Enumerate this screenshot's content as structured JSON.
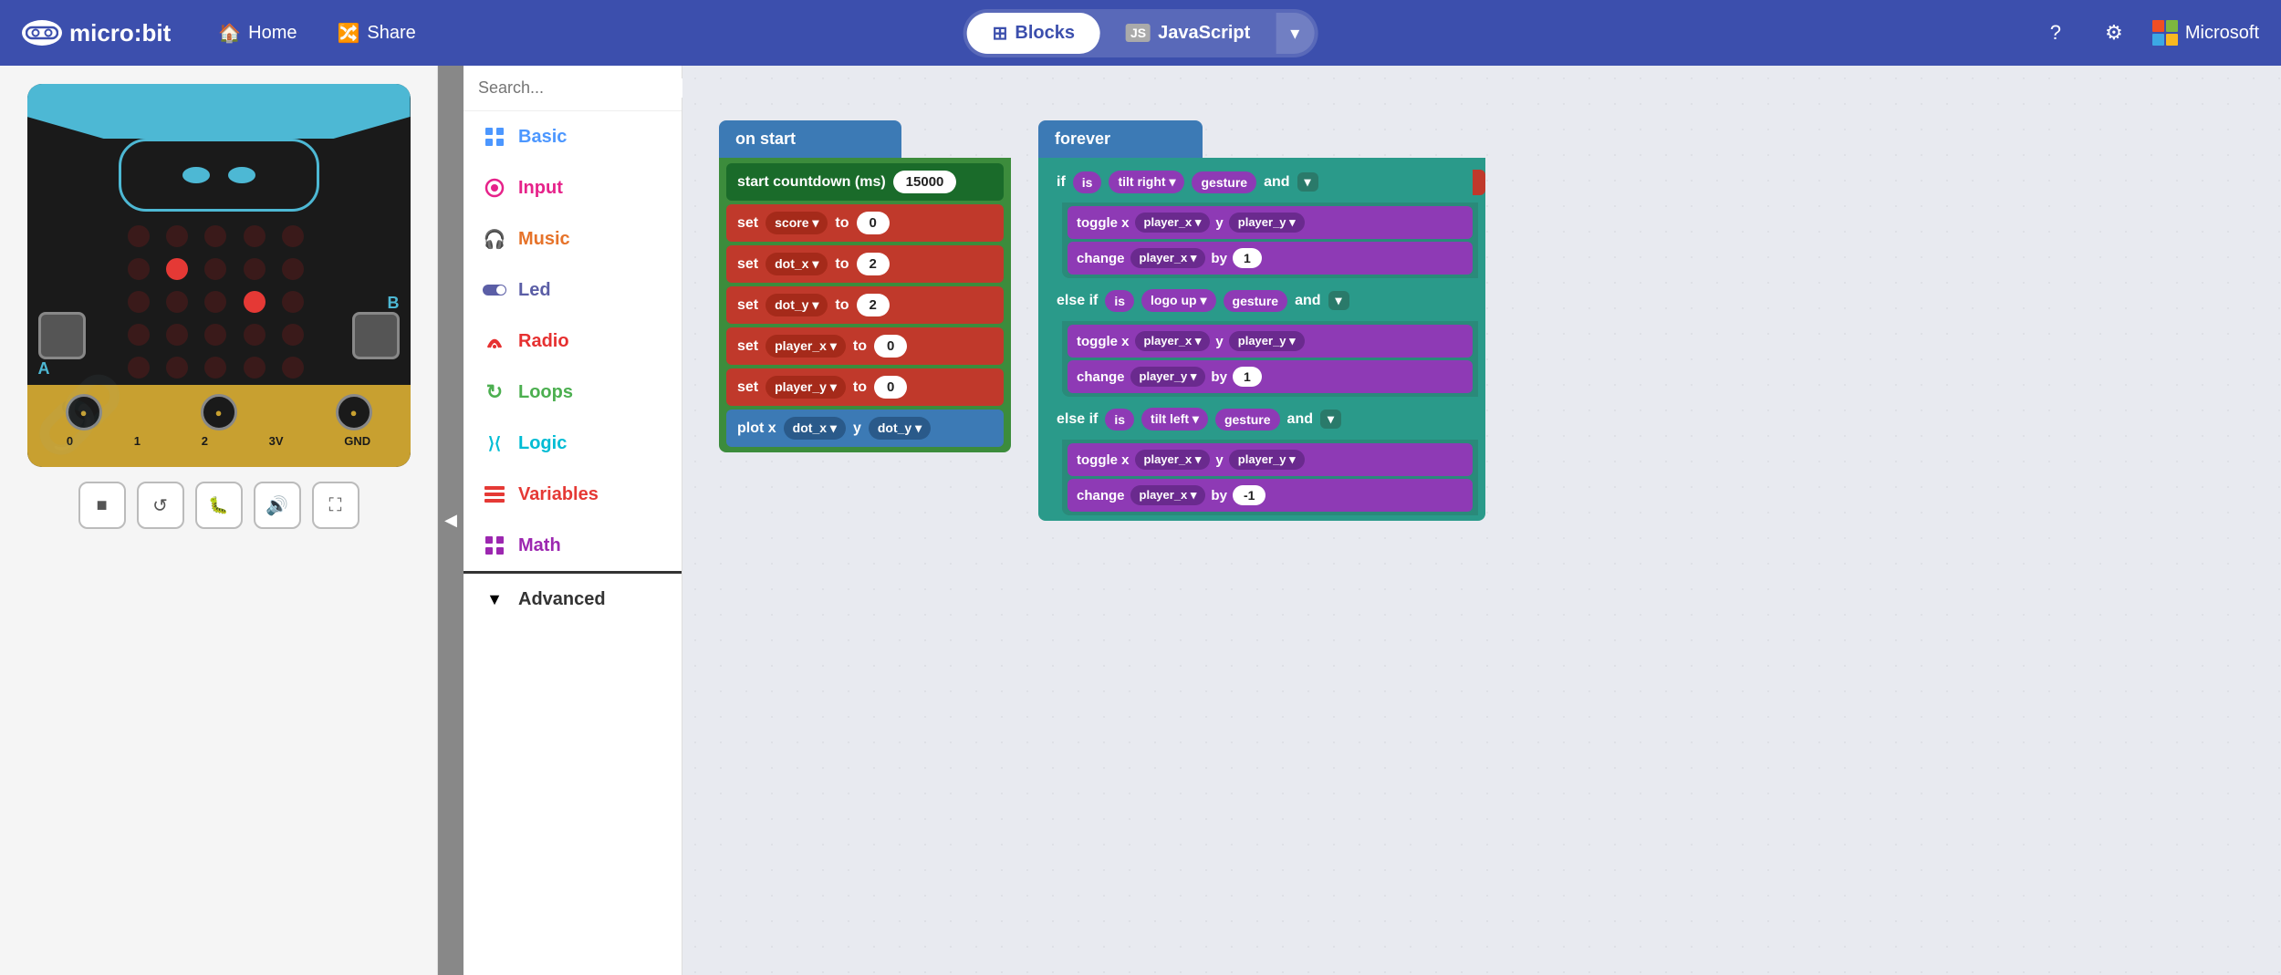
{
  "header": {
    "logo_text": "micro:bit",
    "home_label": "Home",
    "share_label": "Share",
    "blocks_label": "Blocks",
    "javascript_label": "JavaScript",
    "microsoft_label": "Microsoft"
  },
  "toolbox": {
    "search_placeholder": "Search...",
    "items": [
      {
        "id": "basic",
        "label": "Basic",
        "color": "#4c97ff",
        "icon": "grid"
      },
      {
        "id": "input",
        "label": "Input",
        "color": "#e6228a",
        "icon": "circle"
      },
      {
        "id": "music",
        "label": "Music",
        "color": "#e6732a",
        "icon": "headphones"
      },
      {
        "id": "led",
        "label": "Led",
        "color": "#5b5ea6",
        "icon": "toggle"
      },
      {
        "id": "radio",
        "label": "Radio",
        "color": "#e63030",
        "icon": "signal"
      },
      {
        "id": "loops",
        "label": "Loops",
        "color": "#4caf50",
        "icon": "refresh"
      },
      {
        "id": "logic",
        "label": "Logic",
        "color": "#00bcd4",
        "icon": "branch"
      },
      {
        "id": "variables",
        "label": "Variables",
        "color": "#e53935",
        "icon": "list"
      },
      {
        "id": "math",
        "label": "Math",
        "color": "#9c27b0",
        "icon": "grid2"
      },
      {
        "id": "advanced",
        "label": "Advanced",
        "color": "#333",
        "icon": "chevron"
      }
    ]
  },
  "on_start": {
    "hat_label": "on start",
    "countdown_label": "start countdown (ms)",
    "countdown_value": "15000",
    "rows": [
      {
        "label": "set",
        "var": "score",
        "connector": "to",
        "value": "0"
      },
      {
        "label": "set",
        "var": "dot_x",
        "connector": "to",
        "value": "2"
      },
      {
        "label": "set",
        "var": "dot_y",
        "connector": "to",
        "value": "2"
      },
      {
        "label": "set",
        "var": "player_x",
        "connector": "to",
        "value": "0"
      },
      {
        "label": "set",
        "var": "player_y",
        "connector": "to",
        "value": "0"
      }
    ],
    "plot_label": "plot x",
    "plot_x_var": "dot_x",
    "plot_y_label": "y",
    "plot_y_var": "dot_y"
  },
  "forever": {
    "hat_label": "forever",
    "if1": {
      "label": "if",
      "condition": "is",
      "gesture_var": "tilt right",
      "gesture_label": "gesture",
      "connector": "and",
      "inner": [
        {
          "label": "toggle x",
          "x_var": "player_x",
          "y_label": "y",
          "y_var": "player_y"
        },
        {
          "label": "change",
          "var": "player_x",
          "by_label": "by",
          "value": "1"
        }
      ]
    },
    "elseif1": {
      "label": "else if",
      "condition": "is",
      "gesture_var": "logo up",
      "gesture_label": "gesture",
      "connector": "and",
      "inner": [
        {
          "label": "toggle x",
          "x_var": "player_x",
          "y_label": "y",
          "y_var": "player_y"
        },
        {
          "label": "change",
          "var": "player_y",
          "by_label": "by",
          "value": "1"
        }
      ]
    },
    "elseif2": {
      "label": "else if",
      "condition": "is",
      "gesture_var": "tilt left",
      "gesture_label": "gesture",
      "connector": "and",
      "inner": [
        {
          "label": "toggle x",
          "x_var": "player_x",
          "y_label": "y",
          "y_var": "player_y"
        },
        {
          "label": "change",
          "var": "player_x",
          "by_label": "by",
          "value": "-1"
        }
      ]
    }
  },
  "simulator": {
    "controls": [
      {
        "id": "stop",
        "icon": "■",
        "label": "Stop"
      },
      {
        "id": "restart",
        "icon": "↺",
        "label": "Restart"
      },
      {
        "id": "debug",
        "icon": "🐛",
        "label": "Debug"
      },
      {
        "id": "sound",
        "icon": "🔊",
        "label": "Sound"
      },
      {
        "id": "fullscreen",
        "icon": "⛶",
        "label": "Fullscreen"
      }
    ],
    "pin_labels": [
      "0",
      "1",
      "2",
      "3V",
      "GND"
    ]
  }
}
